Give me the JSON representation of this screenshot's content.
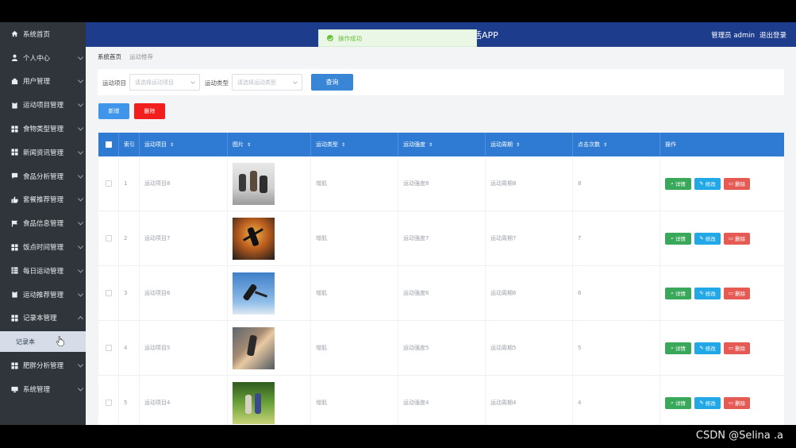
{
  "sidebar": {
    "items": [
      {
        "label": "系统首页",
        "icon": "home-icon",
        "has_children": false
      },
      {
        "label": "个人中心",
        "icon": "user-icon",
        "has_children": true
      },
      {
        "label": "用户管理",
        "icon": "users-icon",
        "has_children": true
      },
      {
        "label": "运动项目管理",
        "icon": "clipboard-icon",
        "has_children": true
      },
      {
        "label": "食物类型管理",
        "icon": "grid-icon",
        "has_children": true
      },
      {
        "label": "新闻资讯管理",
        "icon": "grid-icon",
        "has_children": true
      },
      {
        "label": "食品分析管理",
        "icon": "chat-icon",
        "has_children": true
      },
      {
        "label": "套餐推荐管理",
        "icon": "thumbs-up-icon",
        "has_children": true
      },
      {
        "label": "食品信息管理",
        "icon": "flag-icon",
        "has_children": true
      },
      {
        "label": "饭点时间管理",
        "icon": "grid-icon",
        "has_children": true
      },
      {
        "label": "每日运动管理",
        "icon": "table-icon",
        "has_children": true
      },
      {
        "label": "运动推荐管理",
        "icon": "clipboard-icon",
        "has_children": true
      },
      {
        "label": "记录本管理",
        "icon": "grid-icon",
        "has_children": true,
        "expanded": true,
        "children": [
          "记录本"
        ]
      },
      {
        "label": "肥胖分析管理",
        "icon": "grid-icon",
        "has_children": true
      },
      {
        "label": "系统管理",
        "icon": "monitor-icon",
        "has_children": true
      }
    ]
  },
  "header": {
    "title": "活APP",
    "admin_label": "管理员 admin",
    "logout_label": "退出登录"
  },
  "toast": {
    "text": "操作成功"
  },
  "breadcrumb": {
    "home": "系统首页",
    "current": "运动推荐"
  },
  "search": {
    "label1": "运动项目",
    "placeholder1": "请选择运动项目",
    "label2": "运动类型",
    "placeholder2": "请选择运动类型",
    "query_label": "查询"
  },
  "actions": {
    "add_label": "新增",
    "delete_label": "删除"
  },
  "table": {
    "headers": [
      "索引",
      "运动项目",
      "图片",
      "运动类型",
      "运动强度",
      "运动周期",
      "点击次数",
      "操作"
    ],
    "row_actions": {
      "detail": "详情",
      "edit": "修改",
      "remove": "删除"
    },
    "rows": [
      {
        "index": "1",
        "item": "运动项目8",
        "type": "增肌",
        "intensity": "运动强度8",
        "cycle": "运动周期8",
        "clicks": "8"
      },
      {
        "index": "2",
        "item": "运动项目7",
        "type": "增肌",
        "intensity": "运动强度7",
        "cycle": "运动周期7",
        "clicks": "7"
      },
      {
        "index": "3",
        "item": "运动项目6",
        "type": "增肌",
        "intensity": "运动强度6",
        "cycle": "运动周期6",
        "clicks": "6"
      },
      {
        "index": "4",
        "item": "运动项目5",
        "type": "增肌",
        "intensity": "运动强度5",
        "cycle": "运动周期5",
        "clicks": "5"
      },
      {
        "index": "5",
        "item": "运动项目4",
        "type": "增肌",
        "intensity": "运动强度4",
        "cycle": "运动周期4",
        "clicks": "4"
      }
    ]
  },
  "watermark": "CSDN @Selina .a",
  "colors": {
    "header": "#1d3d8c",
    "sidebar": "#2f353b",
    "table_head": "#2f7bd3",
    "success": "#67c23a",
    "danger": "#f21d1d"
  }
}
